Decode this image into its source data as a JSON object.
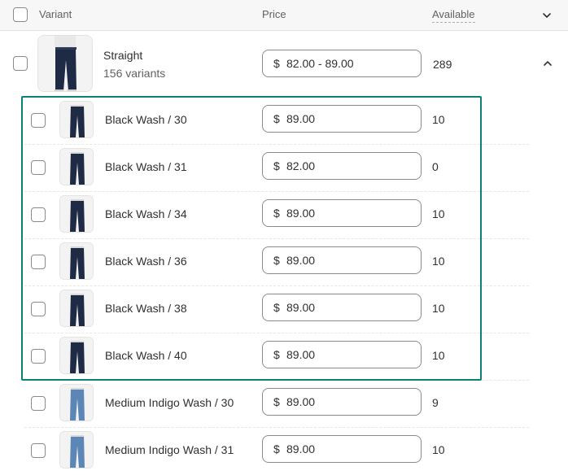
{
  "header": {
    "variant_label": "Variant",
    "price_label": "Price",
    "available_label": "Available"
  },
  "product": {
    "title": "Straight",
    "variants_count": "156 variants",
    "currency": "$",
    "price_range": "82.00 - 89.00",
    "available": "289"
  },
  "variants": [
    {
      "name": "Black Wash / 30",
      "currency": "$",
      "price": "89.00",
      "available": "10",
      "shade": "black"
    },
    {
      "name": "Black Wash / 31",
      "currency": "$",
      "price": "82.00",
      "available": "0",
      "shade": "black"
    },
    {
      "name": "Black Wash / 34",
      "currency": "$",
      "price": "89.00",
      "available": "10",
      "shade": "black"
    },
    {
      "name": "Black Wash / 36",
      "currency": "$",
      "price": "89.00",
      "available": "10",
      "shade": "black"
    },
    {
      "name": "Black Wash / 38",
      "currency": "$",
      "price": "89.00",
      "available": "10",
      "shade": "black"
    },
    {
      "name": "Black Wash / 40",
      "currency": "$",
      "price": "89.00",
      "available": "10",
      "shade": "black"
    },
    {
      "name": "Medium Indigo Wash / 30",
      "currency": "$",
      "price": "89.00",
      "available": "9",
      "shade": "indigo"
    },
    {
      "name": "Medium Indigo Wash / 31",
      "currency": "$",
      "price": "89.00",
      "available": "10",
      "shade": "indigo"
    }
  ],
  "colors": {
    "selection": "#0a8077",
    "black_wash_jean": "#1f2a44",
    "indigo_wash_jean": "#5b86b6"
  }
}
